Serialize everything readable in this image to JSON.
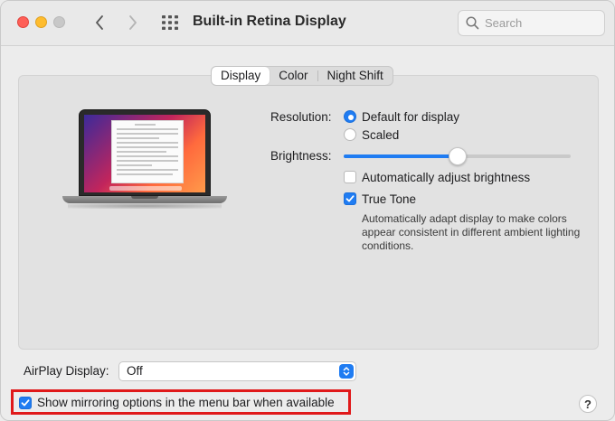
{
  "window": {
    "title": "Built-in Retina Display",
    "search_placeholder": "Search"
  },
  "tabs": [
    {
      "label": "Display",
      "active": true
    },
    {
      "label": "Color",
      "active": false
    },
    {
      "label": "Night Shift",
      "active": false
    }
  ],
  "resolution": {
    "label": "Resolution:",
    "options": [
      {
        "label": "Default for display",
        "selected": true
      },
      {
        "label": "Scaled",
        "selected": false
      }
    ]
  },
  "brightness": {
    "label": "Brightness:",
    "value": 0.5,
    "auto_adjust": {
      "label": "Automatically adjust brightness",
      "checked": false
    }
  },
  "true_tone": {
    "label": "True Tone",
    "checked": true,
    "description": "Automatically adapt display to make colors appear consistent in different ambient lighting conditions."
  },
  "airplay": {
    "label": "AirPlay Display:",
    "selected": "Off"
  },
  "mirroring": {
    "label": "Show mirroring options in the menu bar when available",
    "checked": true
  },
  "help": {
    "label": "?"
  },
  "colors": {
    "accent": "#1f7cf2",
    "highlight_border": "#e0191a"
  }
}
